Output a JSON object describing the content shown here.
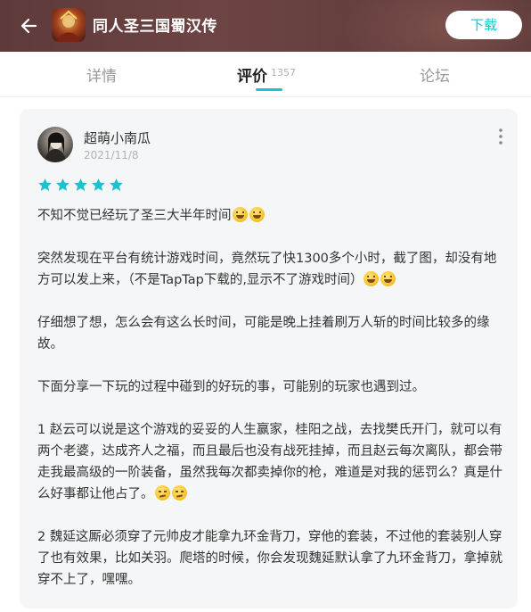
{
  "header": {
    "title": "同人圣三国蜀汉传",
    "download_label": "下载",
    "icons": {
      "back": "back-arrow-icon",
      "app": "app-icon"
    }
  },
  "tabs": [
    {
      "label": "详情",
      "active": false
    },
    {
      "label": "评价",
      "count": "1357",
      "active": true
    },
    {
      "label": "论坛",
      "active": false
    }
  ],
  "review": {
    "username": "超萌小南瓜",
    "date": "2021/11/8",
    "rating": 5,
    "paragraphs": [
      "不知不觉已经玩了圣三大半年时间",
      "突然发现在平台有统计游戏时间，竟然玩了快1300多个小时，截了图，却没有地方可以发上来，（不是TapTap下载的,显示不了游戏时间）",
      "仔细想了想，怎么会有这么长时间，可能是晚上挂着刷万人斩的时间比较多的缘故。",
      "下面分享一下玩的过程中碰到的好玩的事，可能别的玩家也遇到过。",
      "1 赵云可以说是这个游戏的妥妥的人生赢家，桂阳之战，去找樊氏开门，就可以有两个老婆，达成齐人之福，而且最后也没有战死挂掉，而且赵云每次离队，都会带走我最高级的一阶装备，虽然我每次都卖掉你的枪，难道是对我的惩罚么？真是什么好事都让他占了。",
      "2 魏延这厮必须穿了元帅皮才能拿九环金背刀，穿他的套装，不过他的套装别人穿了也有效果，比如关羽。爬塔的时候，你会发现魏延默认拿了九环金背刀，拿掉就穿不上了，嘿嘿。"
    ],
    "emojis": [
      "grin-sweat-emoji",
      "smirk-emoji"
    ]
  },
  "colors": {
    "accent": "#15c5ce",
    "header_bg": "#6d4444",
    "card_bg": "#f5f6f7"
  }
}
